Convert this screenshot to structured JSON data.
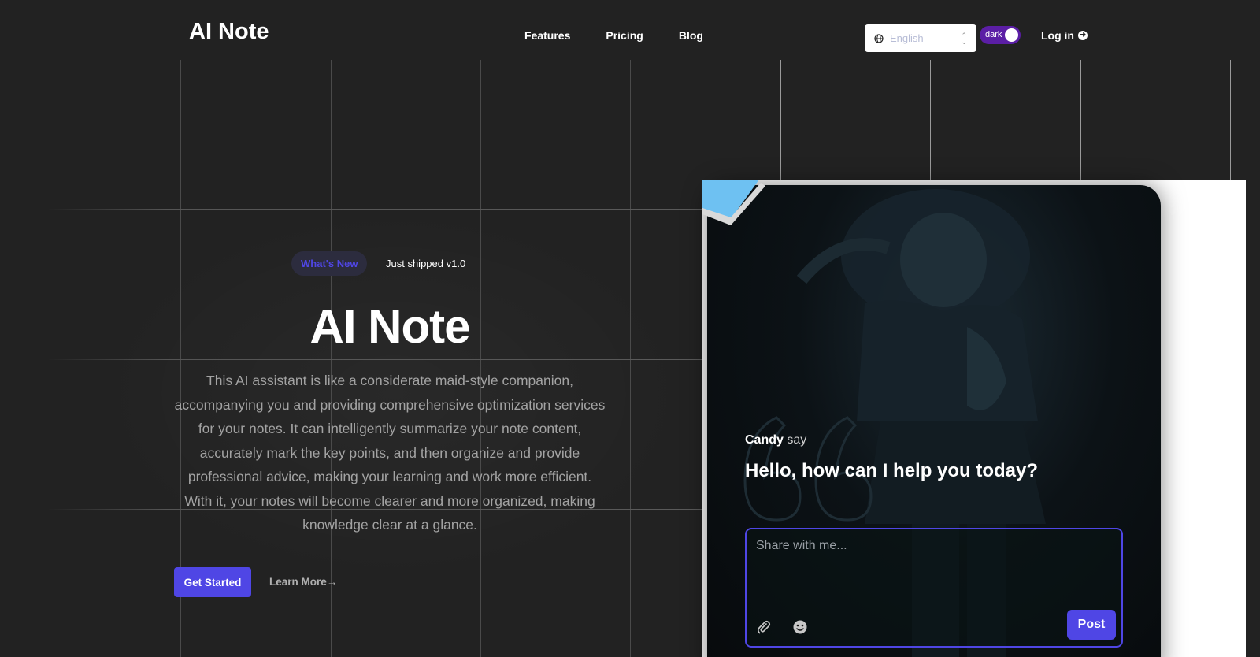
{
  "header": {
    "logo": "AI Note",
    "nav": [
      "Features",
      "Pricing",
      "Blog"
    ],
    "language": "English",
    "theme_label": "dark",
    "login": "Log in"
  },
  "hero": {
    "badge": "What's New",
    "shipped": "Just shipped v1.0",
    "title": "AI Note",
    "description": "This AI assistant is like a considerate maid-style companion, accompanying you and providing comprehensive optimization services for your notes. It can intelligently summarize your note content, accurately mark the key points, and then organize and provide professional advice, making your learning and work more efficient. With it, your notes will become clearer and more organized, making knowledge clear at a glance.",
    "cta_primary": "Get Started",
    "cta_secondary": "Learn More→"
  },
  "chat": {
    "speaker": "Candy",
    "speaker_suffix": "say",
    "greeting": "Hello, how can I help you today?",
    "placeholder": "Share with me...",
    "post": "Post"
  },
  "colors": {
    "background": "#222222",
    "accent": "#4f46e5",
    "toggle": "#5b1ea5"
  }
}
